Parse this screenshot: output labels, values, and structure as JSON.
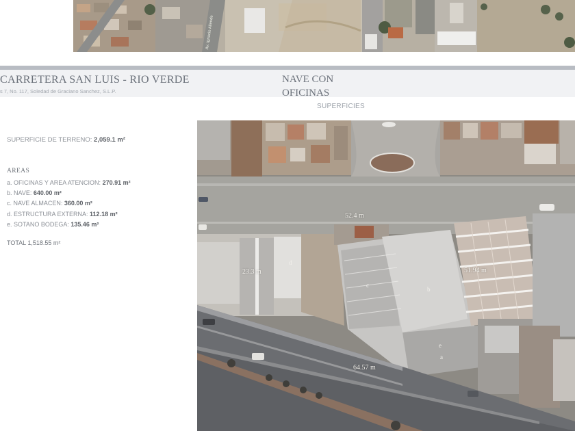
{
  "header": {
    "title": "CARRETERA SAN LUIS - RIO VERDE",
    "address": "s 7, No. 117, Soledad de Graciano Sanchez, S.L.P.",
    "property_type": "NAVE CON OFICINAS",
    "section": "SUPERFICIES"
  },
  "terrain": {
    "label": "SUPERFICIE DE TERRENO:",
    "value": "2,059.1 m²"
  },
  "areas": {
    "title": "AREAS",
    "items": [
      {
        "label": "a. OFICINAS Y AREA ATENCION:",
        "value": "270.91 m²"
      },
      {
        "label": "b. NAVE:",
        "value": "640.00 m²"
      },
      {
        "label": "c. NAVE ALMACEN:",
        "value": "360.00 m²"
      },
      {
        "label": "d. ESTRUCTURA EXTERNA:",
        "value": "112.18 m²"
      },
      {
        "label": "e. SOTANO BODEGA:",
        "value": "135.46 m²"
      }
    ],
    "total": "TOTAL 1,518.55 m²"
  },
  "map": {
    "dimensions": [
      "52.4 m",
      "23.3 m",
      "51.94 m",
      "64.57 m"
    ],
    "labels": [
      "a",
      "b",
      "c",
      "d",
      "e"
    ],
    "street_name": "Av. Ignacio Allende"
  }
}
